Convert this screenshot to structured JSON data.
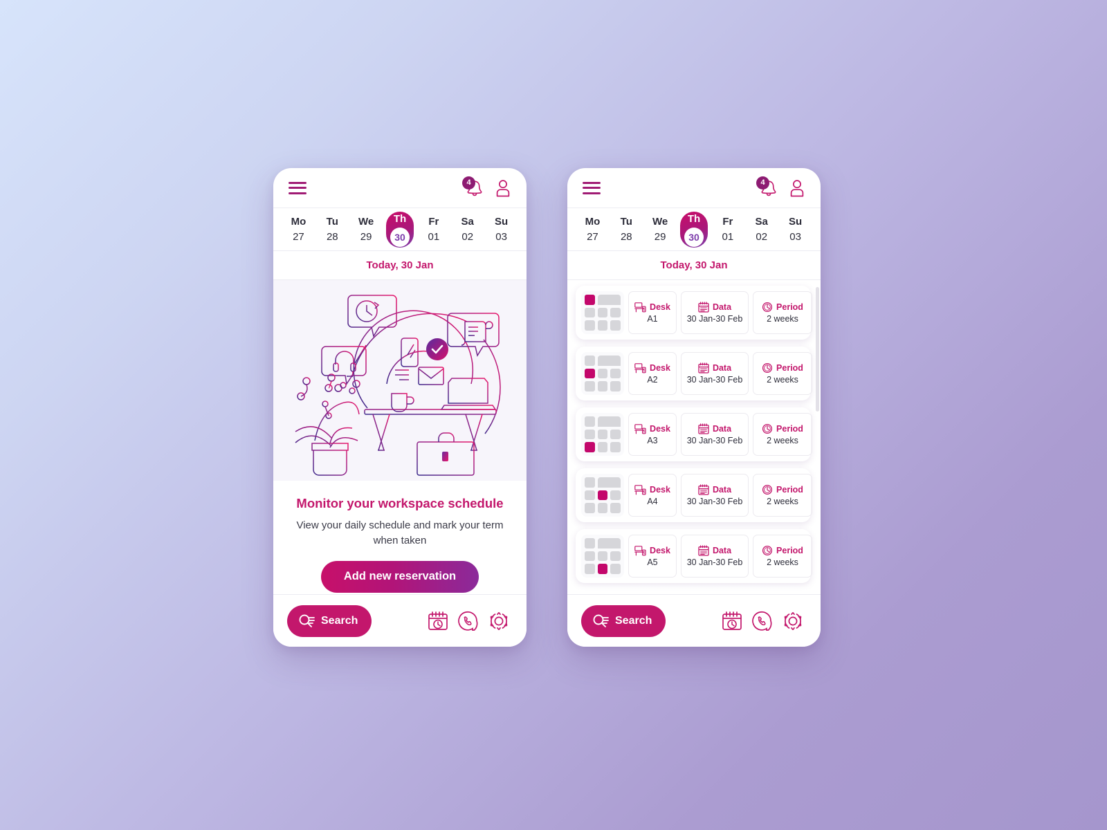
{
  "theme": {
    "accent_pink": "#c3176c",
    "accent_magenta": "#c7106a",
    "accent_purple": "#7c3cab",
    "badge_purple": "#8d1b72",
    "grid_gray": "#d6d6da",
    "bg_from": "#d7e4fb",
    "bg_to": "#a596cd"
  },
  "header": {
    "menu_icon": "hamburger-menu-icon",
    "notifications_icon": "bell-icon",
    "notifications_count": "4",
    "profile_icon": "user-avatar-icon"
  },
  "week": {
    "days": [
      {
        "dow": "Mo",
        "num": "27",
        "selected": false
      },
      {
        "dow": "Tu",
        "num": "28",
        "selected": false
      },
      {
        "dow": "We",
        "num": "29",
        "selected": false
      },
      {
        "dow": "Th",
        "num": "30",
        "selected": true
      },
      {
        "dow": "Fr",
        "num": "01",
        "selected": false
      },
      {
        "dow": "Sa",
        "num": "02",
        "selected": false
      },
      {
        "dow": "Su",
        "num": "03",
        "selected": false
      }
    ]
  },
  "today_label": "Today, 30 Jan",
  "promo": {
    "illustration_name": "workspace-schedule-illustration",
    "title": "Monitor your workspace schedule",
    "subtitle": "View your daily schedule and mark your term when taken",
    "cta_label": "Add new reservation"
  },
  "bottom_nav": {
    "search_label": "Search",
    "search_icon": "search-list-icon",
    "items": [
      {
        "icon": "calendar-clock-icon"
      },
      {
        "icon": "phone-support-icon"
      },
      {
        "icon": "settings-gear-icon"
      }
    ]
  },
  "reservations": {
    "columns": {
      "desk": {
        "label": "Desk",
        "icon": "desk-icon"
      },
      "data": {
        "label": "Data",
        "icon": "calendar-icon"
      },
      "period": {
        "label": "Period",
        "icon": "clock-icon"
      }
    },
    "rows": [
      {
        "desk": "A1",
        "data": "30 Jan-30 Feb",
        "period": "2 weeks",
        "map_cell": 0
      },
      {
        "desk": "A2",
        "data": "30 Jan-30 Feb",
        "period": "2 weeks",
        "map_cell": 3
      },
      {
        "desk": "A3",
        "data": "30 Jan-30 Feb",
        "period": "2 weeks",
        "map_cell": 6
      },
      {
        "desk": "A4",
        "data": "30 Jan-30 Feb",
        "period": "2 weeks",
        "map_cell": 4
      },
      {
        "desk": "A5",
        "data": "30 Jan-30 Feb",
        "period": "2 weeks",
        "map_cell": 7
      }
    ]
  }
}
